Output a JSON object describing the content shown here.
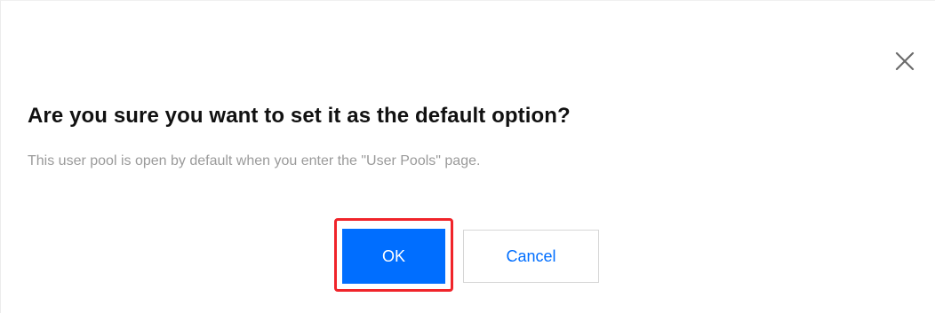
{
  "dialog": {
    "title": "Are you sure you want to set it as the default option?",
    "description": "This user pool is open by default when you enter the \"User Pools\" page.",
    "close_icon": "close-icon",
    "ok_label": "OK",
    "cancel_label": "Cancel"
  },
  "colors": {
    "primary": "#006eff",
    "highlight": "#f0242a",
    "description_text": "#9a9a9a",
    "title_text": "#111111"
  }
}
